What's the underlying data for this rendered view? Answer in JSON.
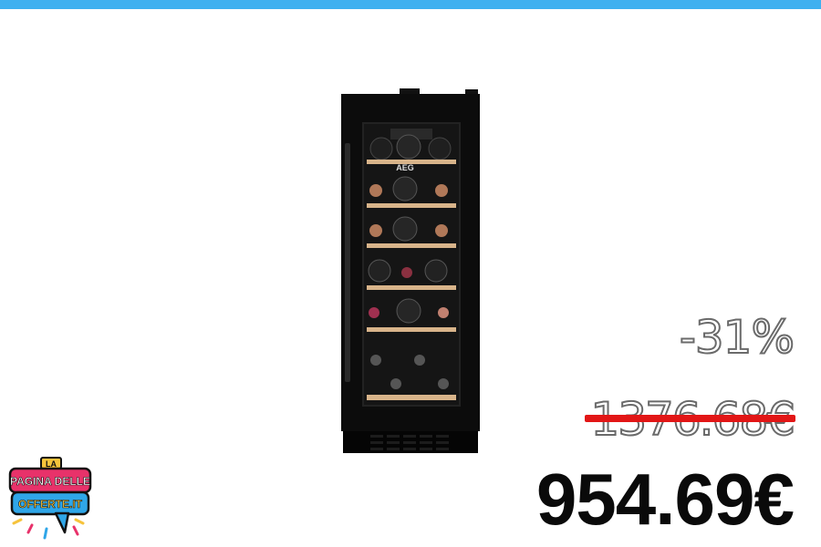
{
  "product": {
    "brand_label": "AEG",
    "icon": "wine-cooler-image"
  },
  "pricing": {
    "discount": "-31%",
    "original_price": "1376.68€",
    "sale_price": "954.69€"
  },
  "logo": {
    "line1": "LA",
    "line2": "PAGINA DELLE",
    "line3": "OFFERTE.IT"
  },
  "colors": {
    "top_bar": "#3eb0f0",
    "strike": "#e21616",
    "logo_pink": "#e8326a",
    "logo_blue": "#2fa6e8",
    "logo_yellow": "#f6c33b"
  }
}
